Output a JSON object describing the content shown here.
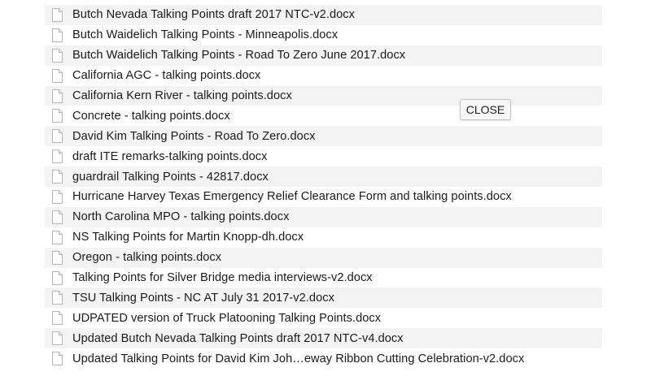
{
  "files": [
    {
      "name": "Butch Nevada Talking Points draft 2017 NTC-v2.docx",
      "icon": "document-icon"
    },
    {
      "name": "Butch Waidelich Talking Points - Minneapolis.docx",
      "icon": "document-icon"
    },
    {
      "name": "Butch Waidelich Talking Points - Road To Zero June 2017.docx",
      "icon": "document-icon"
    },
    {
      "name": "California AGC - talking points.docx",
      "icon": "document-icon"
    },
    {
      "name": "California Kern River - talking points.docx",
      "icon": "document-icon"
    },
    {
      "name": "Concrete - talking points.docx",
      "icon": "document-icon"
    },
    {
      "name": "David Kim Talking Points - Road To Zero.docx",
      "icon": "document-icon"
    },
    {
      "name": "draft ITE remarks-talking points.docx",
      "icon": "document-icon"
    },
    {
      "name": "guardrail Talking Points - 42817.docx",
      "icon": "document-icon"
    },
    {
      "name": "Hurricane Harvey Texas Emergency Relief Clearance Form and talking points.docx",
      "icon": "document-icon"
    },
    {
      "name": "North Carolina MPO - talking points.docx",
      "icon": "document-icon"
    },
    {
      "name": "NS Talking Points for Martin Knopp-dh.docx",
      "icon": "document-icon"
    },
    {
      "name": "Oregon - talking points.docx",
      "icon": "document-icon"
    },
    {
      "name": "Talking Points for Silver Bridge media interviews-v2.docx",
      "icon": "document-icon"
    },
    {
      "name": "TSU Talking Points - NC AT July 31 2017-v2.docx",
      "icon": "document-icon"
    },
    {
      "name": "UDPATED version of Truck Platooning Talking Points.docx",
      "icon": "document-icon"
    },
    {
      "name": "Updated Butch Nevada Talking Points draft 2017 NTC-v4.docx",
      "icon": "document-icon"
    },
    {
      "name": "Updated Talking Points for David Kim Joh…eway Ribbon Cutting Celebration-v2.docx",
      "icon": "document-icon"
    }
  ],
  "close_button": {
    "label": "CLOSE"
  },
  "colors": {
    "row_stripe": "#f3f3f3",
    "row_plain": "#ffffff",
    "text": "#1a1a1a"
  }
}
